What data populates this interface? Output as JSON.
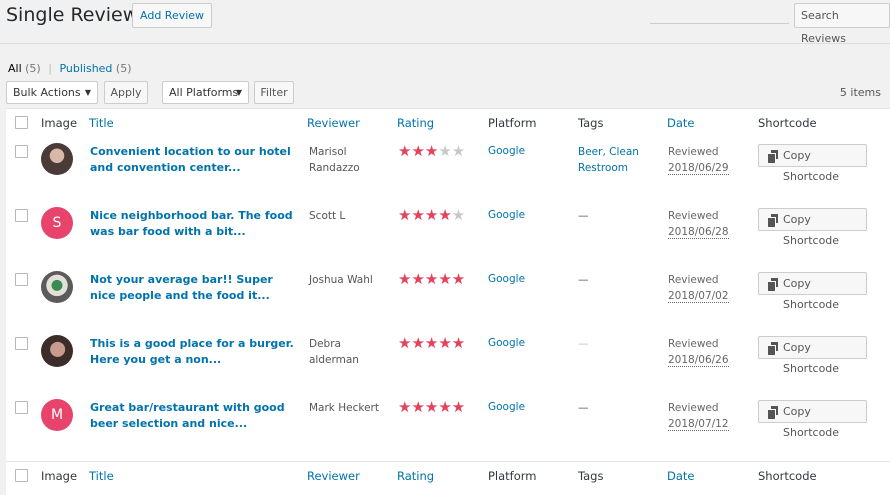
{
  "header": {
    "title": "Single Reviews",
    "add_label": "Add Review",
    "search_placeholder": "",
    "search_button": "Search Reviews"
  },
  "views": {
    "all_label": "All",
    "all_count": "(5)",
    "separator": "|",
    "published_label": "Published",
    "published_count": "(5)"
  },
  "filters": {
    "bulk_actions": "Bulk Actions",
    "apply": "Apply",
    "platforms": "All Platforms",
    "filter": "Filter",
    "items_count": "5 items"
  },
  "columns": {
    "image": "Image",
    "title": "Title",
    "reviewer": "Reviewer",
    "rating": "Rating",
    "platform": "Platform",
    "tags": "Tags",
    "date": "Date",
    "shortcode": "Shortcode"
  },
  "rows": [
    {
      "avatar_letter": "",
      "title": "Convenient location to our hotel and convention center...",
      "reviewer": "Marisol Randazzo",
      "rating": 3,
      "stars_on": "★★★",
      "stars_off": "★★",
      "platform": "Google",
      "tags": "Beer, Clean Restroom",
      "date_label": "Reviewed",
      "date": "2018/06/29",
      "copy": "Copy Shortcode"
    },
    {
      "avatar_letter": "S",
      "title": "Nice neighborhood bar. The food was bar food with a bit...",
      "reviewer": "Scott L",
      "rating": 4,
      "stars_on": "★★★★",
      "stars_off": "★",
      "platform": "Google",
      "tags": "—",
      "date_label": "Reviewed",
      "date": "2018/06/28",
      "copy": "Copy Shortcode"
    },
    {
      "avatar_letter": "",
      "title": "Not your average bar!! Super nice people and the food it...",
      "reviewer": "Joshua Wahl",
      "rating": 5,
      "stars_on": "★★★★★",
      "stars_off": "",
      "platform": "Google",
      "tags": "—",
      "date_label": "Reviewed",
      "date": "2018/07/02",
      "copy": "Copy Shortcode"
    },
    {
      "avatar_letter": "",
      "title": "This is a good place for a burger. Here you get a non...",
      "reviewer": "Debra alderman",
      "rating": 5,
      "stars_on": "★★★★★",
      "stars_off": "",
      "platform": "Google",
      "tags": "—",
      "date_label": "Reviewed",
      "date": "2018/06/26",
      "copy": "Copy Shortcode"
    },
    {
      "avatar_letter": "M",
      "title": "Great bar/restaurant with good beer selection and nice...",
      "reviewer": "Mark Heckert",
      "rating": 5,
      "stars_on": "★★★★★",
      "stars_off": "",
      "platform": "Google",
      "tags": "—",
      "date_label": "Reviewed",
      "date": "2018/07/12",
      "copy": "Copy Shortcode"
    }
  ],
  "colors": {
    "link": "#0073aa",
    "star": "#e2425a",
    "avatar_letter_bg": "#e8446b"
  }
}
